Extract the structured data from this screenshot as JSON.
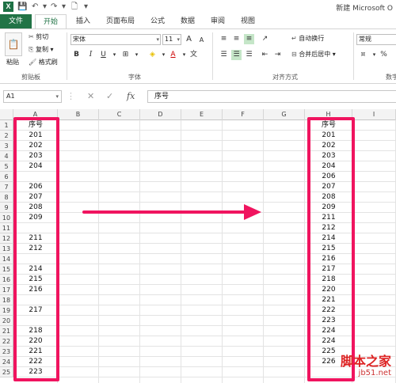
{
  "title_bar": {
    "doc_title": "新建 Microsoft O"
  },
  "tabs": [
    "文件",
    "开始",
    "插入",
    "页面布局",
    "公式",
    "数据",
    "审阅",
    "视图"
  ],
  "clipboard": {
    "paste": "粘贴",
    "cut": "剪切",
    "copy": "复制",
    "format_painter": "格式刷",
    "group": "剪贴板"
  },
  "font": {
    "name": "宋体",
    "size": "11",
    "group": "字体",
    "bold": "B",
    "italic": "I",
    "underline": "U",
    "grow": "A",
    "shrink": "A",
    "font_color": "A",
    "fill_icon": "◈"
  },
  "alignment": {
    "wrap": "自动换行",
    "merge": "合并后居中",
    "group": "对齐方式"
  },
  "number": {
    "format": "常规",
    "group": "数字",
    "percent": "%"
  },
  "formula_bar": {
    "name_box": "A1",
    "fx": "fx",
    "value": "序号",
    "cancel": "✕",
    "confirm": "✓"
  },
  "columns": [
    "A",
    "B",
    "C",
    "D",
    "E",
    "F",
    "G",
    "H",
    "I"
  ],
  "rows": [
    "1",
    "2",
    "3",
    "4",
    "5",
    "6",
    "7",
    "8",
    "9",
    "10",
    "11",
    "12",
    "13",
    "14",
    "15",
    "16",
    "17",
    "18",
    "19",
    "20",
    "21",
    "22",
    "23",
    "24",
    "25"
  ],
  "col_a": [
    "序号",
    "201",
    "202",
    "203",
    "204",
    "",
    "206",
    "207",
    "208",
    "209",
    "",
    "211",
    "212",
    "",
    "214",
    "215",
    "216",
    "",
    "217",
    "",
    "218",
    "220",
    "221",
    "222",
    "223"
  ],
  "col_h": [
    "序号",
    "201",
    "202",
    "203",
    "204",
    "206",
    "207",
    "208",
    "209",
    "211",
    "212",
    "214",
    "215",
    "216",
    "217",
    "218",
    "220",
    "221",
    "222",
    "223",
    "224",
    "224",
    "225",
    "226",
    ""
  ],
  "watermark": {
    "line1": "脚本之家",
    "line2": "jb51.net"
  },
  "colors": {
    "excel_green": "#217346",
    "highlight_pink": "#f0145f"
  }
}
